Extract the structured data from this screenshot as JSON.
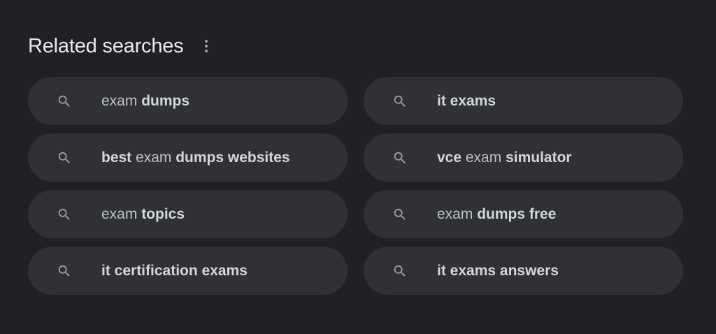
{
  "header": {
    "title": "Related searches",
    "more_icon": "more-vert-icon"
  },
  "search_icon": "search-icon",
  "items": [
    {
      "parts": [
        {
          "t": "exam ",
          "b": false
        },
        {
          "t": "dumps",
          "b": true
        }
      ]
    },
    {
      "parts": [
        {
          "t": "it exams",
          "b": true
        }
      ]
    },
    {
      "parts": [
        {
          "t": "best",
          "b": true
        },
        {
          "t": " exam ",
          "b": false
        },
        {
          "t": "dumps websites",
          "b": true
        }
      ]
    },
    {
      "parts": [
        {
          "t": "vce",
          "b": true
        },
        {
          "t": " exam ",
          "b": false
        },
        {
          "t": "simulator",
          "b": true
        }
      ]
    },
    {
      "parts": [
        {
          "t": "exam ",
          "b": false
        },
        {
          "t": "topics",
          "b": true
        }
      ]
    },
    {
      "parts": [
        {
          "t": "exam ",
          "b": false
        },
        {
          "t": "dumps free",
          "b": true
        }
      ]
    },
    {
      "parts": [
        {
          "t": "it certification exams",
          "b": true
        }
      ]
    },
    {
      "parts": [
        {
          "t": "it exams answers",
          "b": true
        }
      ]
    }
  ],
  "colors": {
    "background": "#202124",
    "chip": "#303134",
    "text": "#bdc1c6",
    "title": "#e8eaed"
  }
}
